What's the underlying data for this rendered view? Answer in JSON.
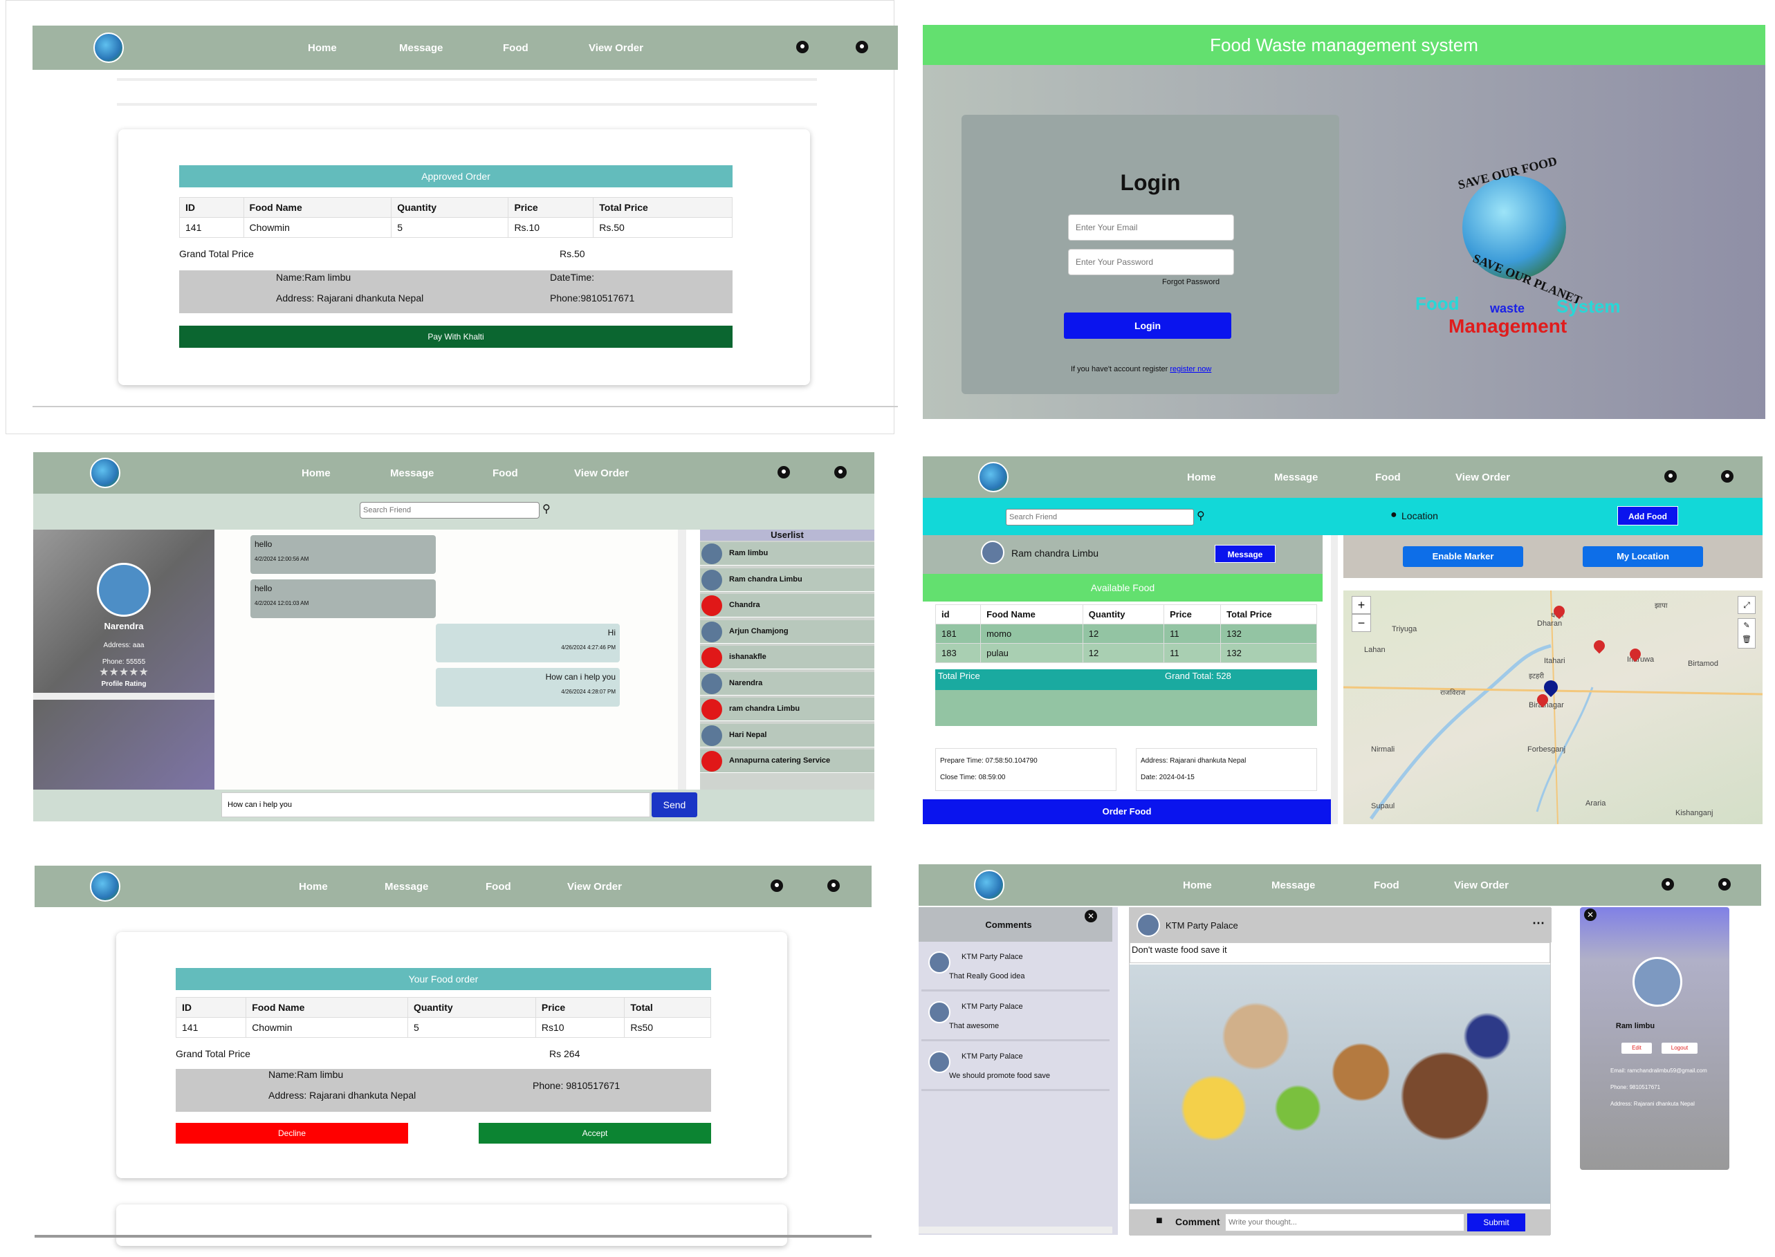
{
  "nav": {
    "home": "Home",
    "message": "Message",
    "food": "Food",
    "view_order": "View Order"
  },
  "approved": {
    "title": "Approved Order",
    "headers": [
      "ID",
      "Food Name",
      "Quantity",
      "Price",
      "Total Price"
    ],
    "row": [
      "141",
      "Chowmin",
      "5",
      "Rs.10",
      "Rs.50"
    ],
    "grand_label": "Grand Total Price",
    "grand_value": "Rs.50",
    "name": "Name:Ram limbu",
    "datetime": "DateTime:",
    "address": "Address: Rajarani dhankuta Nepal",
    "phone": "Phone:9810517671",
    "pay_button": "Pay With Khalti"
  },
  "login": {
    "header": "Food Waste management system",
    "title": "Login",
    "email_placeholder": "Enter Your Email",
    "password_placeholder": "Enter Your Password",
    "forgot": "Forgot Password",
    "button": "Login",
    "register_text": "If you have't account register",
    "register_link": "register now",
    "logo_top": "SAVE OUR FOOD",
    "logo_bottom": "SAVE OUR PLANET",
    "brand_food": "Food",
    "brand_waste": "waste",
    "brand_system": "System",
    "brand_management": "Management"
  },
  "chat": {
    "search_placeholder": "Search Friend",
    "profile_name": "Narendra",
    "profile_address": "Address: aaa",
    "profile_phone": "Phone: 55555",
    "profile_rating": "Profile Rating",
    "messages": [
      {
        "text": "hello",
        "time": "4/2/2024 12:00:56 AM",
        "side": "left"
      },
      {
        "text": "hello",
        "time": "4/2/2024 12:01:03 AM",
        "side": "left"
      },
      {
        "text": "Hi",
        "time": "4/26/2024 4:27:46 PM",
        "side": "right"
      },
      {
        "text": "How can i help you",
        "time": "4/26/2024 4:28:07 PM",
        "side": "right"
      }
    ],
    "userlist_title": "Userlist",
    "users": [
      "Ram limbu",
      "Ram chandra Limbu",
      "Chandra",
      "Arjun Chamjong",
      "ishanakfle",
      "Narendra",
      "ram chandra Limbu",
      "Hari Nepal",
      "Annapurna catering Service"
    ],
    "input_value": "How can i help you",
    "send": "Send"
  },
  "food": {
    "search_placeholder": "Search Friend",
    "location": "Location",
    "add_food": "Add Food",
    "seller": "Ram chandra Limbu",
    "message_btn": "Message",
    "available": "Available Food",
    "headers": [
      "id",
      "Food Name",
      "Quantity",
      "Price",
      "Total Price"
    ],
    "rows": [
      [
        "181",
        "momo",
        "12",
        "11",
        "132"
      ],
      [
        "183",
        "pulau",
        "12",
        "11",
        "132"
      ]
    ],
    "total_label": "Total Price",
    "grand_total": "Grand Total: 528",
    "prepare": "Prepare Time: 07:58:50.104790",
    "close": "Close Time: 08:59:00",
    "address": "Address: Rajarani dhankuta Nepal",
    "date": "Date: 2024-04-15",
    "order": "Order Food",
    "enable_marker": "Enable Marker",
    "my_location": "My Location",
    "map_places": [
      "Dharan",
      "Triyuga",
      "Itahari",
      "Lahan",
      "Biratnagar",
      "Birtamod",
      "Nirmali",
      "Forbesganj",
      "Supaul",
      "Araria",
      "Kishanganj",
      "राजविराज",
      "धरान",
      "झापा",
      "इटहरी",
      "Inaruwa"
    ]
  },
  "your_order": {
    "title": "Your Food order",
    "headers": [
      "ID",
      "Food Name",
      "Quantity",
      "Price",
      "Total"
    ],
    "row": [
      "141",
      "Chowmin",
      "5",
      "Rs10",
      "Rs50"
    ],
    "grand_label": "Grand Total Price",
    "grand_value": "Rs 264",
    "name": "Name:Ram limbu",
    "address": "Address: Rajarani dhankuta Nepal",
    "phone": "Phone: 9810517671",
    "decline": "Decline",
    "accept": "Accept"
  },
  "post": {
    "comments_title": "Comments",
    "comments": [
      {
        "author": "KTM Party Palace",
        "text": "That Really Good idea"
      },
      {
        "author": "KTM Party Palace",
        "text": "That awesome"
      },
      {
        "author": "KTM Party Palace",
        "text": "We should promote food save"
      }
    ],
    "author": "KTM Party Palace",
    "caption": "Don't waste food save it",
    "comment_label": "Comment",
    "comment_placeholder": "Write your thought...",
    "submit": "Submit",
    "profile_name": "Ram limbu",
    "edit": "Edit",
    "logout": "Logout",
    "email": "Email: ramchandralimbu59@gmail.com",
    "phone": "Phone: 9810517671",
    "address": "Address: Rajarani dhankuta Nepal"
  },
  "colors": {
    "nav": "#a0b4a2",
    "green_header": "#63e06f",
    "teal": "#63bcbc",
    "blue": "#0a14ee",
    "dark_green": "#0b6630"
  }
}
